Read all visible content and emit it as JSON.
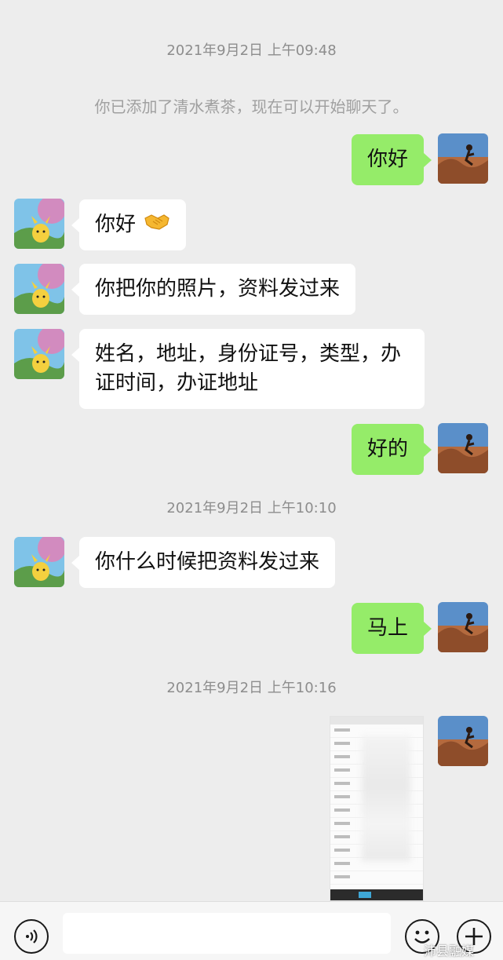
{
  "timestamps": {
    "t1": "2021年9月2日 上午09:48",
    "t2": "2021年9月2日 上午10:10",
    "t3": "2021年9月2日 上午10:16"
  },
  "system_note": "你已添加了清水煮茶，现在可以开始聊天了。",
  "messages": {
    "m1": "你好",
    "m2": "你好",
    "m3": "你把你的照片，资料发过来",
    "m4_line1": "姓名，地址，身份证号，类型，办",
    "m4_line2": "证时间，办证地址",
    "m5": "好的",
    "m6": "你什么时候把资料发过来",
    "m7": "马上"
  },
  "icons": {
    "voice": "voice-input-icon",
    "emoji": "emoji-smile-icon",
    "plus": "plus-icon",
    "handshake": "handshake-emoji-icon"
  },
  "watermark": "沛县融媒",
  "colors": {
    "background": "#ededed",
    "outgoing_bubble": "#95ec69",
    "incoming_bubble": "#ffffff"
  }
}
